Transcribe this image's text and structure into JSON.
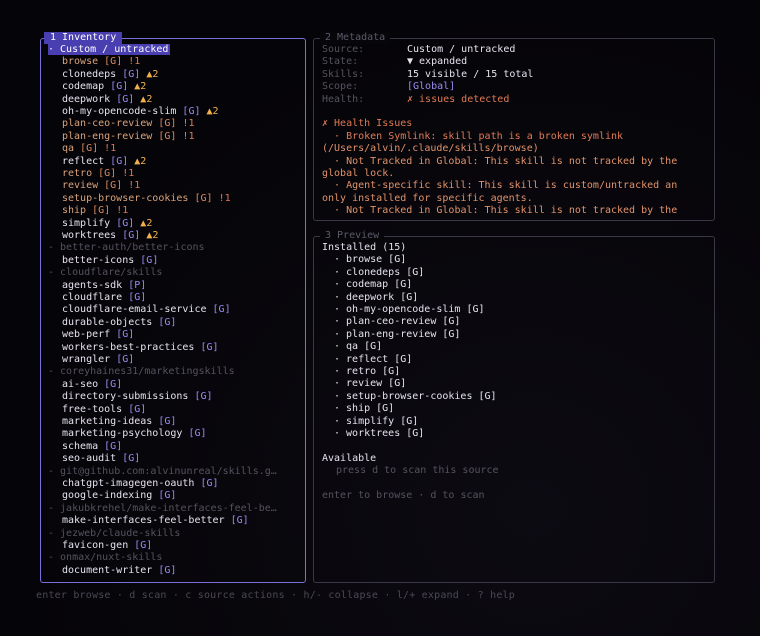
{
  "inventory": {
    "title": "1 Inventory",
    "groups": [
      {
        "header": "· Custom / untracked",
        "selected": true,
        "items": [
          {
            "name": "browse",
            "tag": "[G]",
            "status": "!1",
            "style": "sk-dim"
          },
          {
            "name": "clonedeps",
            "tag": "[G]",
            "status": "▲2",
            "style": "sk-white"
          },
          {
            "name": "codemap",
            "tag": "[G]",
            "status": "▲2",
            "style": "sk-white"
          },
          {
            "name": "deepwork",
            "tag": "[G]",
            "status": "▲2",
            "style": "sk-white"
          },
          {
            "name": "oh-my-opencode-slim",
            "tag": "[G]",
            "status": "▲2",
            "style": "sk-white"
          },
          {
            "name": "plan-ceo-review",
            "tag": "[G]",
            "status": "!1",
            "style": "sk-dim"
          },
          {
            "name": "plan-eng-review",
            "tag": "[G]",
            "status": "!1",
            "style": "sk-dim"
          },
          {
            "name": "qa",
            "tag": "[G]",
            "status": "!1",
            "style": "sk-dim"
          },
          {
            "name": "reflect",
            "tag": "[G]",
            "status": "▲2",
            "style": "sk-white"
          },
          {
            "name": "retro",
            "tag": "[G]",
            "status": "!1",
            "style": "sk-dim"
          },
          {
            "name": "review",
            "tag": "[G]",
            "status": "!1",
            "style": "sk-dim"
          },
          {
            "name": "setup-browser-cookies",
            "tag": "[G]",
            "status": "!1",
            "style": "sk-dim"
          },
          {
            "name": "ship",
            "tag": "[G]",
            "status": "!1",
            "style": "sk-dim"
          },
          {
            "name": "simplify",
            "tag": "[G]",
            "status": "▲2",
            "style": "sk-white"
          },
          {
            "name": "worktrees",
            "tag": "[G]",
            "status": "▲2",
            "style": "sk-white"
          }
        ]
      },
      {
        "header": "- better-auth/better-icons",
        "items": [
          {
            "name": "better-icons",
            "tag": "[G]",
            "status": "",
            "style": "sk-white"
          }
        ]
      },
      {
        "header": "- cloudflare/skills",
        "items": [
          {
            "name": "agents-sdk",
            "tag": "[P]",
            "status": "",
            "style": "sk-white"
          },
          {
            "name": "cloudflare",
            "tag": "[G]",
            "status": "",
            "style": "sk-white"
          },
          {
            "name": "cloudflare-email-service",
            "tag": "[G]",
            "status": "",
            "style": "sk-white"
          },
          {
            "name": "durable-objects",
            "tag": "[G]",
            "status": "",
            "style": "sk-white"
          },
          {
            "name": "web-perf",
            "tag": "[G]",
            "status": "",
            "style": "sk-white"
          },
          {
            "name": "workers-best-practices",
            "tag": "[G]",
            "status": "",
            "style": "sk-white"
          },
          {
            "name": "wrangler",
            "tag": "[G]",
            "status": "",
            "style": "sk-white"
          }
        ]
      },
      {
        "header": "- coreyhaines31/marketingskills",
        "items": [
          {
            "name": "ai-seo",
            "tag": "[G]",
            "status": "",
            "style": "sk-white"
          },
          {
            "name": "directory-submissions",
            "tag": "[G]",
            "status": "",
            "style": "sk-white"
          },
          {
            "name": "free-tools",
            "tag": "[G]",
            "status": "",
            "style": "sk-white"
          },
          {
            "name": "marketing-ideas",
            "tag": "[G]",
            "status": "",
            "style": "sk-white"
          },
          {
            "name": "marketing-psychology",
            "tag": "[G]",
            "status": "",
            "style": "sk-white"
          },
          {
            "name": "schema",
            "tag": "[G]",
            "status": "",
            "style": "sk-white"
          },
          {
            "name": "seo-audit",
            "tag": "[G]",
            "status": "",
            "style": "sk-white"
          }
        ]
      },
      {
        "header": "- git@github.com:alvinunreal/skills.g…",
        "items": [
          {
            "name": "chatgpt-imagegen-oauth",
            "tag": "[G]",
            "status": "",
            "style": "sk-white"
          },
          {
            "name": "google-indexing",
            "tag": "[G]",
            "status": "",
            "style": "sk-white"
          }
        ]
      },
      {
        "header": "- jakubkrehel/make-interfaces-feel-be…",
        "items": [
          {
            "name": "make-interfaces-feel-better",
            "tag": "[G]",
            "status": "",
            "style": "sk-white"
          }
        ]
      },
      {
        "header": "- jezweb/claude-skills",
        "items": [
          {
            "name": "favicon-gen",
            "tag": "[G]",
            "status": "",
            "style": "sk-white"
          }
        ]
      },
      {
        "header": "- onmax/nuxt-skills",
        "items": [
          {
            "name": "document-writer",
            "tag": "[G]",
            "status": "",
            "style": "sk-white"
          }
        ]
      }
    ]
  },
  "metadata": {
    "title": "2 Metadata",
    "fields": [
      {
        "label": "Source:",
        "value": "Custom / untracked",
        "style": "val"
      },
      {
        "label": "State:",
        "value": "▼ expanded",
        "style": "val"
      },
      {
        "label": "Skills:",
        "value": "15 visible / 15 total",
        "style": "val"
      },
      {
        "label": "Scope:",
        "value": "[Global]",
        "style": "val-purple"
      },
      {
        "label": "Health:",
        "value": "✗ issues detected",
        "style": "val-red"
      }
    ],
    "issues_title": "✗ Health Issues",
    "issues": [
      {
        "text": "  · Broken Symlink: skill path is a broken symlink",
        "style": "iss-t"
      },
      {
        "text": "(/Users/alvin/.claude/skills/browse)",
        "style": "iss-d"
      },
      {
        "text": "  · Not Tracked in Global: This skill is not tracked by the",
        "style": "iss-d"
      },
      {
        "text": "global lock.",
        "style": "iss-d"
      },
      {
        "text": "  · Agent-specific skill: This skill is custom/untracked an",
        "style": "iss-d"
      },
      {
        "text": "only installed for specific agents.",
        "style": "iss-d"
      },
      {
        "text": "  · Not Tracked in Global: This skill is not tracked by the",
        "style": "iss-d"
      }
    ]
  },
  "preview": {
    "title": "3 Preview",
    "installed_label": "Installed (15)",
    "installed": [
      "· browse [G]",
      "· clonedeps [G]",
      "· codemap [G]",
      "· deepwork [G]",
      "· oh-my-opencode-slim [G]",
      "· plan-ceo-review [G]",
      "· plan-eng-review [G]",
      "· qa [G]",
      "· reflect [G]",
      "· retro [G]",
      "· review [G]",
      "· setup-browser-cookies [G]",
      "· ship [G]",
      "· simplify [G]",
      "· worktrees [G]"
    ],
    "available_label": "Available",
    "available_hint": "press d to scan this source",
    "actions_hint": "enter to browse · d to scan"
  },
  "footer": "enter browse · d scan · c source actions · h/- collapse · l/+ expand · ? help"
}
